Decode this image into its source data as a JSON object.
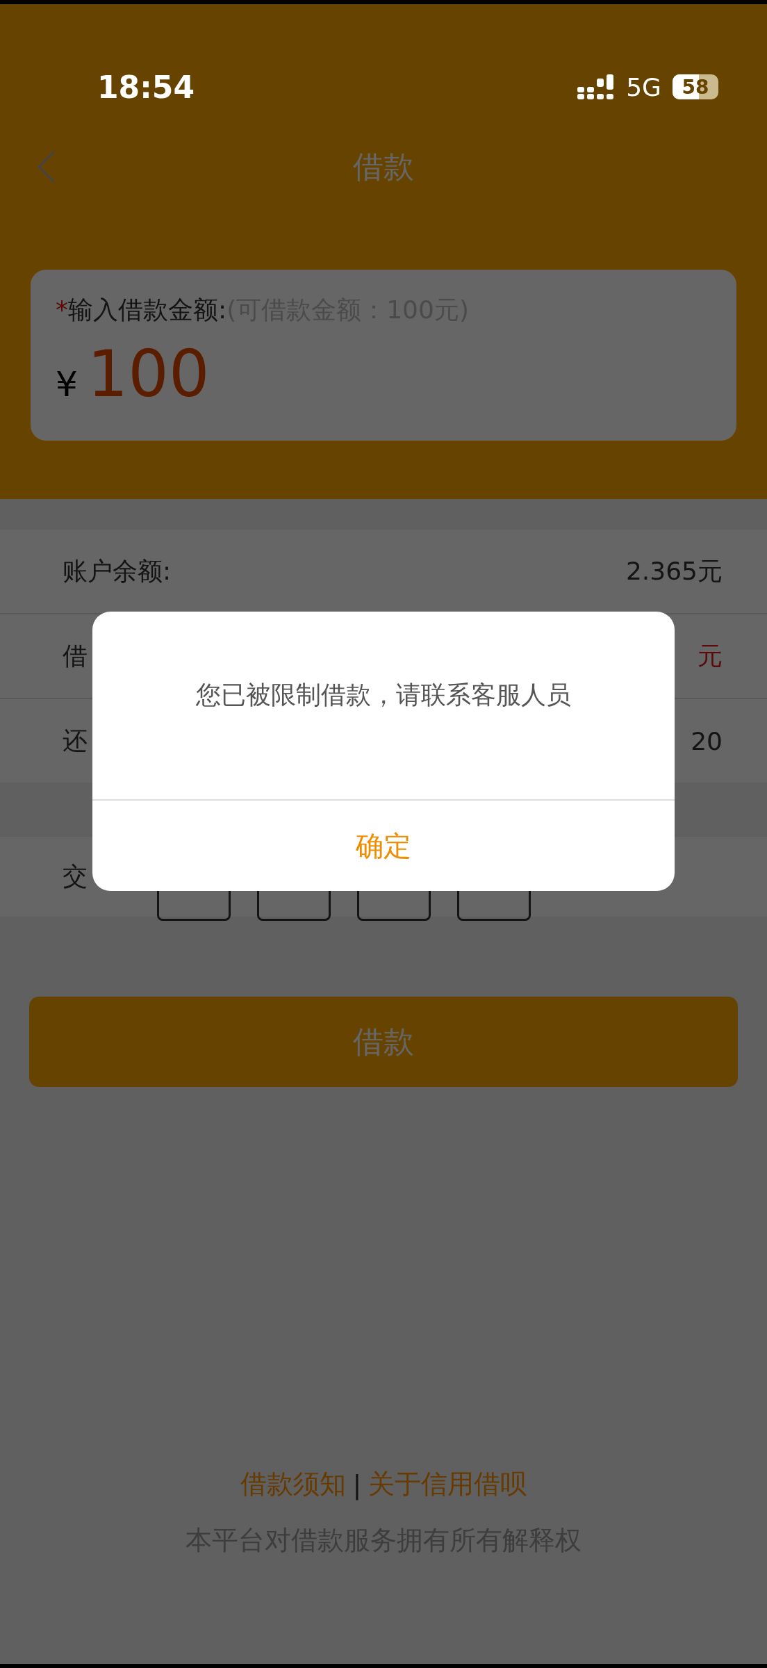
{
  "status_bar": {
    "time": "18:54",
    "network": "5G",
    "battery": "58"
  },
  "nav": {
    "title": "借款"
  },
  "amount_card": {
    "required_mark": "*",
    "label": "输入借款金额:",
    "hint": "(可借款金额：100元)",
    "currency": "¥",
    "value": "100"
  },
  "rows": [
    {
      "label": "账户余额:",
      "value": "2.365元",
      "kind": "plain"
    },
    {
      "label": "借",
      "value": "元",
      "kind": "highlight"
    },
    {
      "label": "还",
      "value": "20",
      "kind": "plain"
    }
  ],
  "code_row": {
    "label": "交"
  },
  "submit_button": "借款",
  "footer": {
    "links": [
      "借款须知",
      "关于信用借呗"
    ],
    "separator": "|",
    "note": "本平台对借款服务拥有所有解释权"
  },
  "dialog": {
    "message": "您已被限制借款，请联系客服人员",
    "button": "确定"
  }
}
